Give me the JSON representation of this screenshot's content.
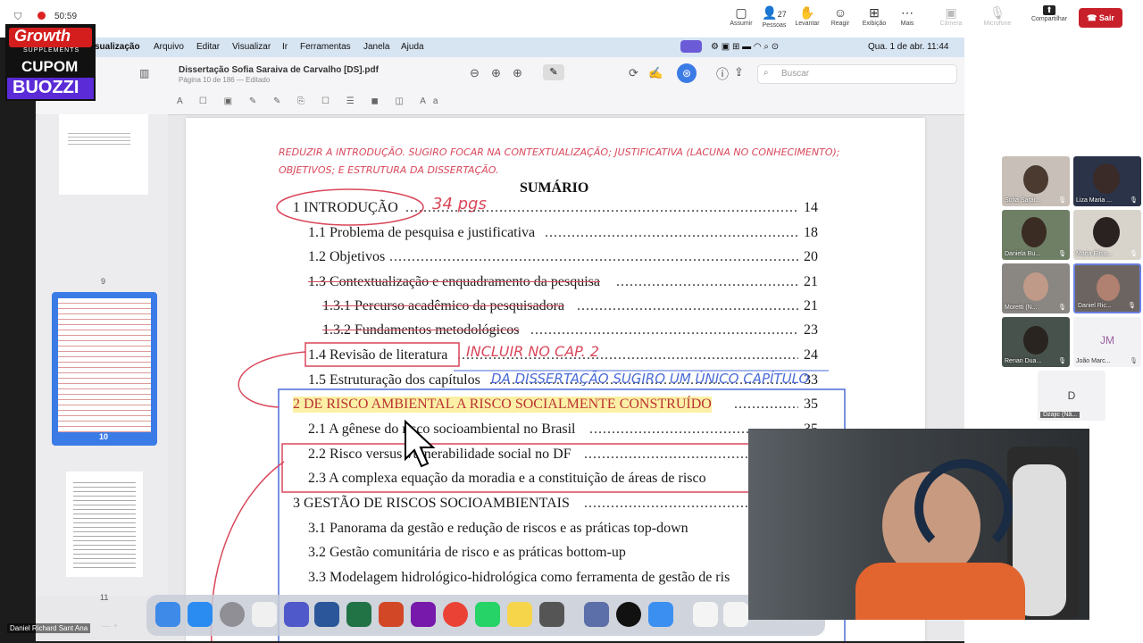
{
  "meet": {
    "status_time": "50:59",
    "toolbar": [
      {
        "label": "Assumir",
        "icon": "monitor-icon",
        "glyph": "▢"
      },
      {
        "label": "Pessoas",
        "icon": "people-icon",
        "glyph": "👤",
        "count": "27"
      },
      {
        "label": "Levantar",
        "icon": "hand-icon",
        "glyph": "✋"
      },
      {
        "label": "Reagir",
        "icon": "smile-icon",
        "glyph": "☺"
      },
      {
        "label": "Exibição",
        "icon": "grid-icon",
        "glyph": "⊞"
      },
      {
        "label": "Mais",
        "icon": "more-icon",
        "glyph": "⋯"
      },
      {
        "label": "Câmera",
        "icon": "camera-off-icon",
        "glyph": "▣"
      },
      {
        "label": "Microfone",
        "icon": "mic-off-icon",
        "glyph": "🎙"
      },
      {
        "label": "Compartilhar",
        "icon": "share-icon",
        "glyph": "⬆"
      }
    ],
    "leave_label": "Sair",
    "participants": [
      {
        "name": "Sofia Sarai..."
      },
      {
        "name": "Liza Maria ..."
      },
      {
        "name": "Daniela Bu..."
      },
      {
        "name": "Maria Elisa..."
      },
      {
        "name": "Moretti (N..."
      },
      {
        "name": "Daniel Ric..."
      },
      {
        "name": "Renan Dua..."
      },
      {
        "name": "João Marc...",
        "initials": "JM"
      },
      {
        "name": "Dzajic (Nã...",
        "initials": "D"
      }
    ],
    "self_name": "Daniel Richard Sant Ana"
  },
  "overlay_logo": {
    "line1": "Growth",
    "line2": "SUPPLEMENTS",
    "line3": "CUPOM",
    "line4": "BUOZZI"
  },
  "mac": {
    "menu": [
      "sualização",
      "Arquivo",
      "Editar",
      "Visualizar",
      "Ir",
      "Ferramentas",
      "Janela",
      "Ajuda"
    ],
    "clock": "Qua. 1 de abr.  11:44"
  },
  "pdf": {
    "filename": "Dissertação Sofia Saraiva de Carvalho [DS].pdf",
    "subtitle": "Página 10 de 186  — Editado",
    "search_placeholder": "Buscar",
    "thumb_labels": [
      "9",
      "10",
      "11"
    ],
    "heading": "SUMÁRIO",
    "toc": [
      {
        "text": "1 INTRODUÇÃO",
        "page": "14"
      },
      {
        "text": "1.1 Problema de pesquisa e justificativa",
        "page": "18"
      },
      {
        "text": "1.2 Objetivos",
        "page": "20"
      },
      {
        "text": "1.3 Contextualização e enquadramento da pesquisa",
        "page": "21"
      },
      {
        "text": "1.3.1 Percurso acadêmico da pesquisadora",
        "page": "21"
      },
      {
        "text": "1.3.2 Fundamentos metodológicos",
        "page": "23"
      },
      {
        "text": "1.4 Revisão de literatura",
        "page": "24"
      },
      {
        "text": "1.5 Estruturação dos capítulos",
        "page": "33"
      },
      {
        "text": "2 DE RISCO AMBIENTAL A RISCO SOCIALMENTE CONSTRUÍDO",
        "page": "35"
      },
      {
        "text": "2.1 A gênese do risco socioambiental no Brasil",
        "page": "35"
      },
      {
        "text": "2.2 Risco versus vulnerabilidade social no DF",
        "page": ""
      },
      {
        "text": "2.3 A complexa equação da moradia e a constituição de áreas de risco",
        "page": ""
      },
      {
        "text": "3 GESTÃO DE RISCOS SOCIOAMBIENTAIS",
        "page": ""
      },
      {
        "text": "3.1 Panorama da gestão e redução de riscos e as práticas top-down",
        "page": ""
      },
      {
        "text": "3.2 Gestão comunitária de risco e as práticas bottom-up",
        "page": ""
      },
      {
        "text": "3.3 Modelagem hidrológico-hidrológica como ferramenta de gestão de ris",
        "page": ""
      }
    ],
    "annotations": {
      "note1": "REDUZIR A INTRODUÇÃO. SUGIRO FOCAR NA CONTEXTUALIZAÇÃO; JUSTIFICATIVA (LACUNA NO CONHECIMENTO);",
      "note2": "OBJETIVOS; E ESTRUTURA DA DISSERTAÇÃO.",
      "pages": "34 pgs",
      "inclue": "INCLUIR NO CAP. 2",
      "blue": "DA DISSERTAÇÃO  SUGIRO UM ÚNICO CAPÍTULO"
    }
  }
}
